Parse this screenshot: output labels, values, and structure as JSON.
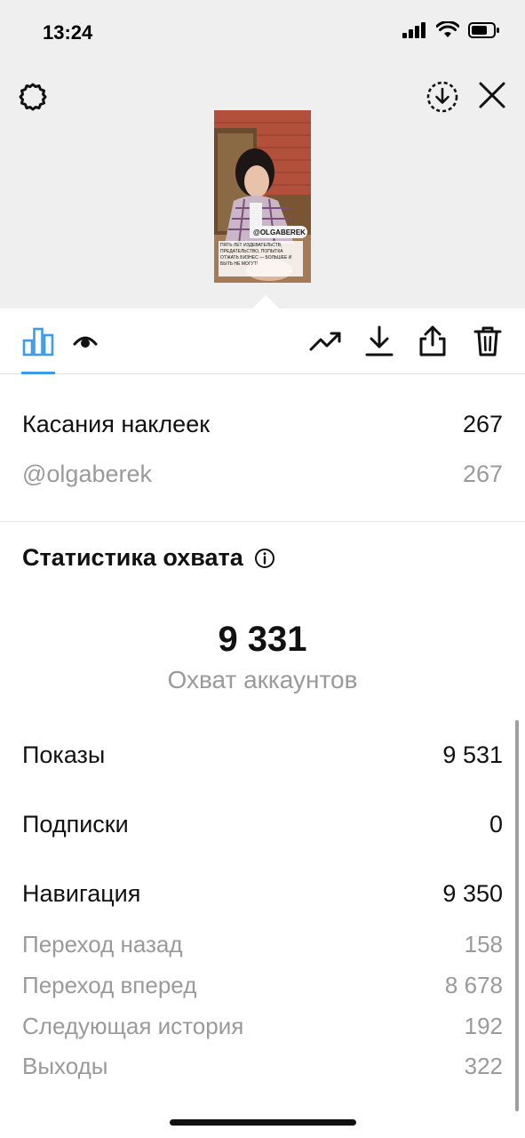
{
  "status": {
    "time": "13:24"
  },
  "story_preview": {
    "mention": "@OLGABEREK",
    "caption": "ПЯТЬ ЛЕТ ИЗДЕВАТЕЛЬСТВ, ПРЕДАТЕЛЬСТВО, ПОПЫТКА ОТЖАТЬ БИЗНЕС — БОЛЬШЕЕ И БЫТЬ НЕ МОГУТ!"
  },
  "sticker_taps": {
    "label": "Касания наклеек",
    "value": "267",
    "items": [
      {
        "label": "@olgaberek",
        "value": "267"
      }
    ]
  },
  "reach": {
    "title": "Статистика охвата",
    "accounts_reached": "9 331",
    "accounts_reached_label": "Охват аккаунтов",
    "impressions": {
      "label": "Показы",
      "value": "9 531"
    },
    "follows": {
      "label": "Подписки",
      "value": "0"
    },
    "navigation": {
      "label": "Навигация",
      "value": "9 350",
      "items": [
        {
          "label": "Переход назад",
          "value": "158"
        },
        {
          "label": "Переход вперед",
          "value": "8 678"
        },
        {
          "label": "Следующая история",
          "value": "192"
        },
        {
          "label": "Выходы",
          "value": "322"
        }
      ]
    }
  },
  "colors": {
    "accent": "#3b9ce8",
    "dim_text": "#9a9a9a",
    "top_bg": "#efefef"
  }
}
